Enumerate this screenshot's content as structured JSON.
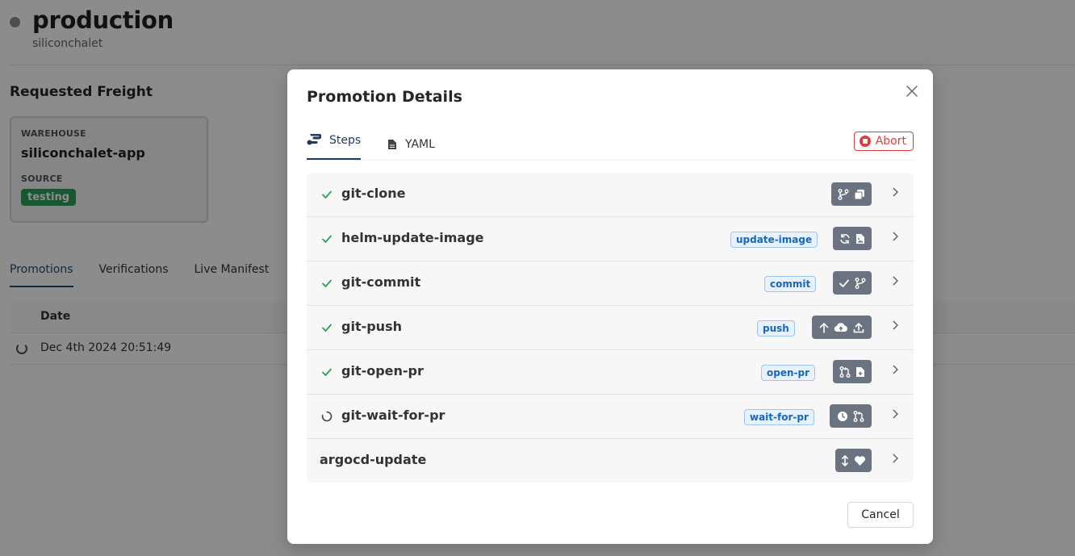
{
  "background": {
    "stage_title": "production",
    "stage_subtitle": "siliconchalet",
    "requested_freight_title": "Requested Freight",
    "freight_card": {
      "warehouse_label": "WAREHOUSE",
      "warehouse_value": "siliconchalet-app",
      "source_label": "SOURCE",
      "source_value": "testing"
    },
    "tabs": [
      "Promotions",
      "Verifications",
      "Live Manifest"
    ],
    "table_header_date": "Date",
    "table_row_date": "Dec 4th 2024 20:51:49"
  },
  "modal": {
    "title": "Promotion Details",
    "tabs": {
      "steps": "Steps",
      "yaml": "YAML"
    },
    "abort_label": "Abort",
    "cancel_label": "Cancel",
    "steps": [
      {
        "name": "git-clone",
        "alias": "",
        "status": "done",
        "icons": [
          "git-branch-icon",
          "copy-icon"
        ]
      },
      {
        "name": "helm-update-image",
        "alias": "update-image",
        "status": "done",
        "icons": [
          "refresh-icon",
          "file-image-icon"
        ]
      },
      {
        "name": "git-commit",
        "alias": "commit",
        "status": "done",
        "icons": [
          "check-icon",
          "git-branch-icon"
        ]
      },
      {
        "name": "git-push",
        "alias": "push",
        "status": "done",
        "icons": [
          "arrow-up-icon",
          "cloud-upload-icon",
          "upload-icon"
        ]
      },
      {
        "name": "git-open-pr",
        "alias": "open-pr",
        "status": "done",
        "icons": [
          "pull-request-icon",
          "file-plus-icon"
        ]
      },
      {
        "name": "git-wait-for-pr",
        "alias": "wait-for-pr",
        "status": "running",
        "icons": [
          "clock-icon",
          "pull-request-icon"
        ]
      },
      {
        "name": "argocd-update",
        "alias": "",
        "status": "pending",
        "icons": [
          "arrows-vertical-icon",
          "heart-icon"
        ]
      }
    ]
  },
  "colors": {
    "accent": "#1f3a5f",
    "success": "#2e9e5b",
    "danger": "#e23b3b",
    "alias_text": "#1766c2",
    "icon_chip": "#6b7280"
  }
}
